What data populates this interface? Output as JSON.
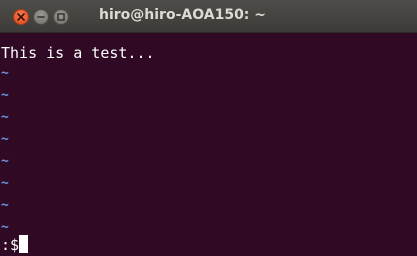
{
  "window": {
    "title": "hiro@hiro-AOA150: ~"
  },
  "titlebar_buttons": {
    "close_icon": "close-icon",
    "minimize_icon": "minimize-icon",
    "maximize_icon": "maximize-icon"
  },
  "terminal": {
    "text_line": "This is a test...",
    "empty_line_marker": "~",
    "command_line": ":$",
    "colors": {
      "background": "#300a24",
      "foreground": "#ffffff",
      "tilde": "#6f8fe0"
    }
  }
}
